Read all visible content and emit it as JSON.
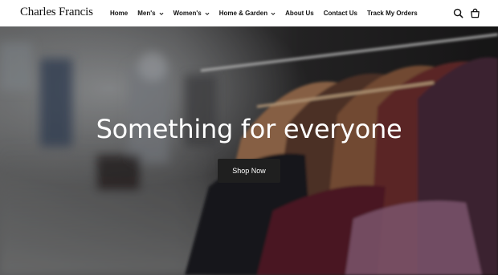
{
  "brand": {
    "name": "Charles Francis"
  },
  "nav": {
    "items": [
      {
        "label": "Home",
        "has_dropdown": false
      },
      {
        "label": "Men's",
        "has_dropdown": true
      },
      {
        "label": "Women's",
        "has_dropdown": true
      },
      {
        "label": "Home & Garden",
        "has_dropdown": true
      },
      {
        "label": "About Us",
        "has_dropdown": false
      },
      {
        "label": "Contact Us",
        "has_dropdown": false
      },
      {
        "label": "Track My Orders",
        "has_dropdown": false
      }
    ]
  },
  "header_icons": [
    "search-icon",
    "cart-icon"
  ],
  "hero": {
    "title": "Something for everyone",
    "button_label": "Shop Now"
  },
  "colors": {
    "header_bg": "#ffffff",
    "text": "#111111",
    "hero_button_bg": "#1f1f1f",
    "hero_text": "#ffffff"
  }
}
